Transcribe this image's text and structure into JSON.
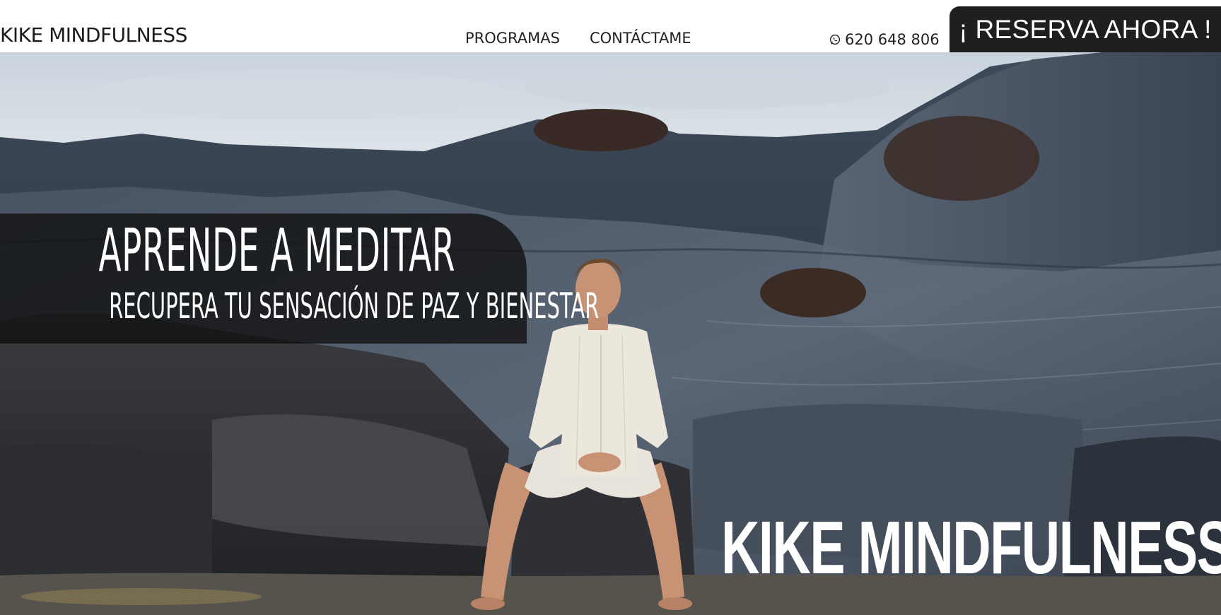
{
  "header": {
    "brand": "KIKE MINDFULNESS",
    "nav": [
      "PROGRAMAS",
      "CONTÁCTAME"
    ],
    "phone": "620 648 806",
    "phone_icon": "whatsapp-icon",
    "cta_label": "¡ RESERVA AHORA !"
  },
  "hero": {
    "headline": "APRENDE A MEDITAR",
    "subheadline": "RECUPERA TU SENSACIÓN DE PAZ Y BIENESTAR",
    "logo_text": "KIKE MINDFULNESS",
    "image": "meditating-man-on-volcanic-rocks"
  },
  "colors": {
    "cta_bg": "#1f1f1f",
    "overlay": "#0f0f0f",
    "text_dark": "#1b1b1b",
    "text_light": "#ffffff"
  }
}
